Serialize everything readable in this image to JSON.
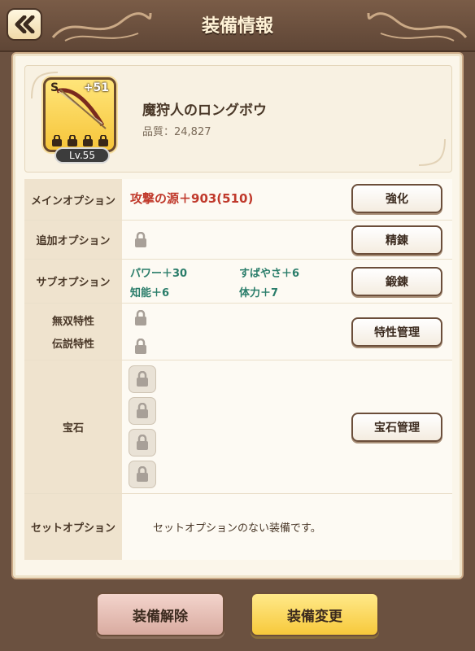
{
  "header": {
    "title": "装備情報",
    "back_icon": "double-chevron-left-icon"
  },
  "item": {
    "name": "魔狩人のロングボウ",
    "quality": "品質：24,827",
    "grade": "S",
    "enhance": "+51",
    "level": "Lv.55",
    "icon": "longbow-icon"
  },
  "rows": {
    "main": {
      "label": "メインオプション",
      "value": "攻撃の源＋903(510)",
      "button": "強化"
    },
    "extra": {
      "label": "追加オプション",
      "button": "精錬"
    },
    "sub": {
      "label": "サブオプション",
      "stats": [
        "パワー＋30",
        "すばやさ＋6",
        "知能＋6",
        "体力＋7"
      ],
      "button": "鍛錬"
    },
    "musou": {
      "label": "無双特性"
    },
    "legend": {
      "label": "伝説特性",
      "button": "特性管理"
    },
    "gem": {
      "label": "宝石",
      "button": "宝石管理"
    },
    "set": {
      "label": "セットオプション",
      "value": "セットオプションのない装備です。"
    }
  },
  "footer": {
    "unequip": "装備解除",
    "change": "装備変更"
  },
  "colors": {
    "main_option": "#c0392b",
    "sub_option": "#2a7d6a",
    "change_button": "#f7c93b",
    "unequip_button": "#e0b4a8"
  }
}
